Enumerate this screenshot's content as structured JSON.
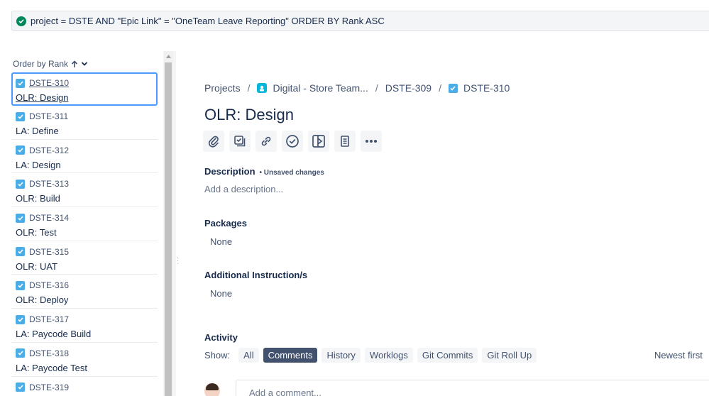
{
  "jql": {
    "query": "project = DSTE AND \"Epic Link\" = \"OneTeam Leave Reporting\" ORDER BY Rank ASC"
  },
  "list": {
    "order_label": "Order by Rank",
    "issues": [
      {
        "key": "DSTE-310",
        "summary": "OLR: Design"
      },
      {
        "key": "DSTE-311",
        "summary": "LA: Define"
      },
      {
        "key": "DSTE-312",
        "summary": "LA: Design"
      },
      {
        "key": "DSTE-313",
        "summary": "OLR: Build"
      },
      {
        "key": "DSTE-314",
        "summary": "OLR: Test"
      },
      {
        "key": "DSTE-315",
        "summary": "OLR: UAT"
      },
      {
        "key": "DSTE-316",
        "summary": "OLR: Deploy"
      },
      {
        "key": "DSTE-317",
        "summary": "LA: Paycode Build"
      },
      {
        "key": "DSTE-318",
        "summary": "LA: Paycode Test"
      },
      {
        "key": "DSTE-319",
        "summary": ""
      }
    ]
  },
  "breadcrumb": {
    "projects": "Projects",
    "project": "Digital - Store Team...",
    "parent": "DSTE-309",
    "current": "DSTE-310"
  },
  "issue": {
    "title": "OLR: Design",
    "description_label": "Description",
    "unsaved": "• Unsaved changes",
    "description_placeholder": "Add a description...",
    "packages_label": "Packages",
    "packages_value": "None",
    "instructions_label": "Additional Instruction/s",
    "instructions_value": "None"
  },
  "activity": {
    "label": "Activity",
    "show": "Show:",
    "filters": [
      "All",
      "Comments",
      "History",
      "Worklogs",
      "Git Commits",
      "Git Roll Up"
    ],
    "active": "Comments",
    "sort": "Newest first",
    "comment_placeholder": "Add a comment..."
  },
  "colors": {
    "accent": "#4c9aff",
    "active_pill": "#42526e",
    "check": "#4bade8",
    "ok": "#00875a"
  }
}
